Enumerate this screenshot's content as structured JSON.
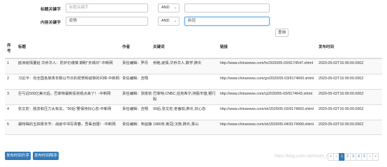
{
  "search": {
    "title_label": "标题关键字",
    "title_placeholder": "标题关键字",
    "content_label": "内容关键字",
    "content_value": "疫情",
    "op1": "AND",
    "op2": "AND",
    "extra_value": "新冠",
    "query_button": "查询"
  },
  "table": {
    "headers": [
      "序号",
      "标题",
      "作者",
      "关键词",
      "链接",
      "发布时间"
    ],
    "rows": [
      {
        "idx": "1",
        "title": "欧洲疫情蔓延 华侨华人：防护仍谨慎 期盼\"天晴日\"-中新网",
        "author": "责任编辑：罗丹",
        "keywords": "侨胞,疫情,华侨华人,数学,肺炎",
        "link": "http://www.chinanews.com/hr/2020/05-03/9174547.shtml",
        "time": "2020-05-02T16:00:00.000Z"
      },
      {
        "idx": "2",
        "title": "习近平：向全国各族青年致以节日的祝贺和诚挚的问候-中新网",
        "author": "责任编辑：吉翔",
        "keywords": "",
        "link": "http://www.chinanews.com/gn/2020/05-03/9174660.shtml",
        "time": "2020-05-02T16:00:00.000Z"
      },
      {
        "idx": "3",
        "title": "巨亏近500亿美元后，巴菲特最新投资观点来了！-中新网",
        "author": "责任编辑：张俊钦",
        "keywords": "巴菲特,CNBC,伯克希尔,持股市值,银行股",
        "link": "http://www.chinanews.com/cj/2020/05-03/9174643.shtml",
        "time": "2020-05-02T16:00:00.000Z"
      },
      {
        "idx": "4",
        "title": "张文宏：脱发和压力太有关，\"90后\"要保持好心态-中新网",
        "author": "责任编辑：吉翔",
        "keywords": "90后,张文宏,老番茄,肺炎,好心态",
        "link": "http://www.chinanews.com/sh/2020/05-03/9174893.shtml",
        "time": "2020-05-02T16:00:00.000Z"
      },
      {
        "idx": "5",
        "title": "最特殊的五四青年节：战疫中书写青春，吾辈自强！-中新网",
        "author": "责任编辑：朱延静",
        "keywords": "1980年,新冠,汉族,肺炎,青山",
        "link": "http://www.chinanews.com/sh/2020/05-04/9174999.shtml",
        "time": "2020-05-03T16:00:00.000Z"
      }
    ]
  },
  "actions": {
    "sort_asc": "发布时间升序",
    "sort_desc": "发布时间降序"
  },
  "pagination": {
    "first": "«",
    "prev": "‹",
    "pages": [
      "1",
      "2",
      "3",
      "4",
      "5"
    ],
    "next": "›",
    "last": "»",
    "current": "1"
  },
  "watermark": "https://blog.csdn.net/Hoshi_Hu"
}
